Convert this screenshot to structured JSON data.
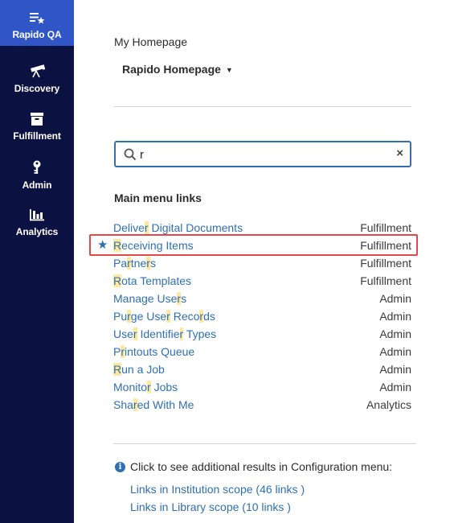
{
  "sidebar": {
    "items": [
      {
        "label": "Rapido QA",
        "icon": "list-star-icon",
        "active": true
      },
      {
        "label": "Discovery",
        "icon": "telescope-icon"
      },
      {
        "label": "Fulfillment",
        "icon": "archive-box-icon"
      },
      {
        "label": "Admin",
        "icon": "key-icon"
      },
      {
        "label": "Analytics",
        "icon": "bar-chart-icon"
      }
    ]
  },
  "homepage": {
    "section_label": "My Homepage",
    "selected": "Rapido Homepage",
    "caret": "▼"
  },
  "search": {
    "value": "r",
    "clear": "×"
  },
  "menu_links": {
    "title": "Main menu links",
    "rows": [
      {
        "parts": [
          "Delive",
          "r",
          " Digital Documents"
        ],
        "category": "Fulfillment"
      },
      {
        "parts": [
          "",
          "R",
          "eceiving Items"
        ],
        "category": "Fulfillment",
        "starred": true
      },
      {
        "parts": [
          "Pa",
          "r",
          "tne",
          "r",
          "s"
        ],
        "category": "Fulfillment"
      },
      {
        "parts": [
          "",
          "R",
          "ota Templates"
        ],
        "category": "Fulfillment"
      },
      {
        "parts": [
          "Manage Use",
          "r",
          "s"
        ],
        "category": "Admin"
      },
      {
        "parts": [
          "Pu",
          "r",
          "ge Use",
          "r",
          " Reco",
          "r",
          "ds"
        ],
        "category": "Admin"
      },
      {
        "parts": [
          "Use",
          "r",
          " Identifie",
          "r",
          " Types"
        ],
        "category": "Admin"
      },
      {
        "parts": [
          "P",
          "r",
          "intouts Queue"
        ],
        "category": "Admin"
      },
      {
        "parts": [
          "",
          "R",
          "un a Job"
        ],
        "category": "Admin"
      },
      {
        "parts": [
          "Monito",
          "r",
          " Jobs"
        ],
        "category": "Admin"
      },
      {
        "parts": [
          "Sha",
          "r",
          "ed With Me"
        ],
        "category": "Analytics"
      }
    ]
  },
  "config": {
    "info_icon": "i",
    "text": "Click to see additional results in Configuration menu:",
    "links": [
      "Links in Institution scope (46 links )",
      "Links in Library scope (10 links )"
    ]
  },
  "colors": {
    "sidebar_bg": "#0b1140",
    "sidebar_active": "#2f55c7",
    "link": "#2f6fb2",
    "match_highlight": "#fde8a0",
    "selection_frame": "#e0484a"
  }
}
